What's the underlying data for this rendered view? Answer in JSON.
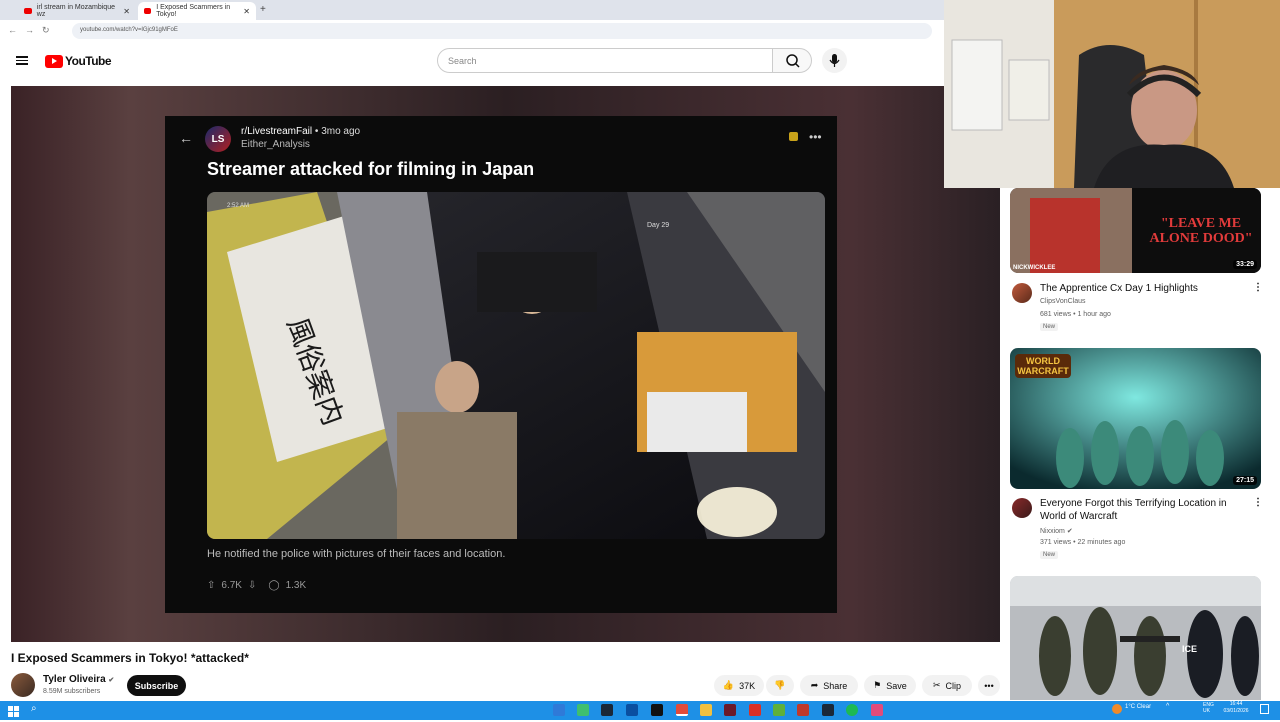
{
  "browser": {
    "tabs": [
      {
        "label": "irl stream in Mozambique wz"
      },
      {
        "label": "I Exposed Scammers in Tokyo!"
      }
    ],
    "url": "youtube.com/watch?v=lGjc91gMFoE"
  },
  "header": {
    "logo_text": "YouTube",
    "search_placeholder": "Search"
  },
  "reddit_post": {
    "avatar_text": "LS",
    "subreddit": "r/LivestreamFail",
    "age": "• 3mo ago",
    "user": "Either_Analysis",
    "title": "Streamer attacked for filming in Japan",
    "caption": "He notified the police with pictures of their faces and location.",
    "upvotes": "6.7K",
    "comments": "1.3K"
  },
  "video": {
    "title": "I Exposed Scammers in Tokyo! *attacked*",
    "channel": "Tyler Oliveira",
    "subscribers": "8.59M subscribers",
    "subscribe_label": "Subscribe",
    "likes": "37K",
    "share_label": "Share",
    "save_label": "Save",
    "clip_label": "Clip"
  },
  "sidebar": {
    "videos": [
      {
        "title": "The Apprentice Cx Day 1 Highlights",
        "channel": "ClipsVonClaus",
        "meta": "681 views • 1 hour ago",
        "badge": "New",
        "duration": "33:29",
        "thumb_text": "\"LEAVE ME ALONE DOOD\"",
        "thumb_sub": "NICKWICKLEE"
      },
      {
        "title": "Everyone Forgot this Terrifying Location in World of Warcraft",
        "channel": "Nixxiom",
        "meta": "371 views • 22 minutes ago",
        "badge": "New",
        "duration": "27:15",
        "thumb_text": "WORLD WARCRAFT"
      },
      {
        "title": "",
        "channel": "",
        "meta": "",
        "badge": "",
        "duration": "",
        "thumb_text": "ICE"
      }
    ]
  },
  "taskbar": {
    "weather": "1°C Clear",
    "lang": "ENG UK",
    "time": "16:44",
    "date": "03/01/2026"
  },
  "colors": {
    "youtube_red": "#ff0000",
    "taskbar_blue": "#1e90e6"
  }
}
